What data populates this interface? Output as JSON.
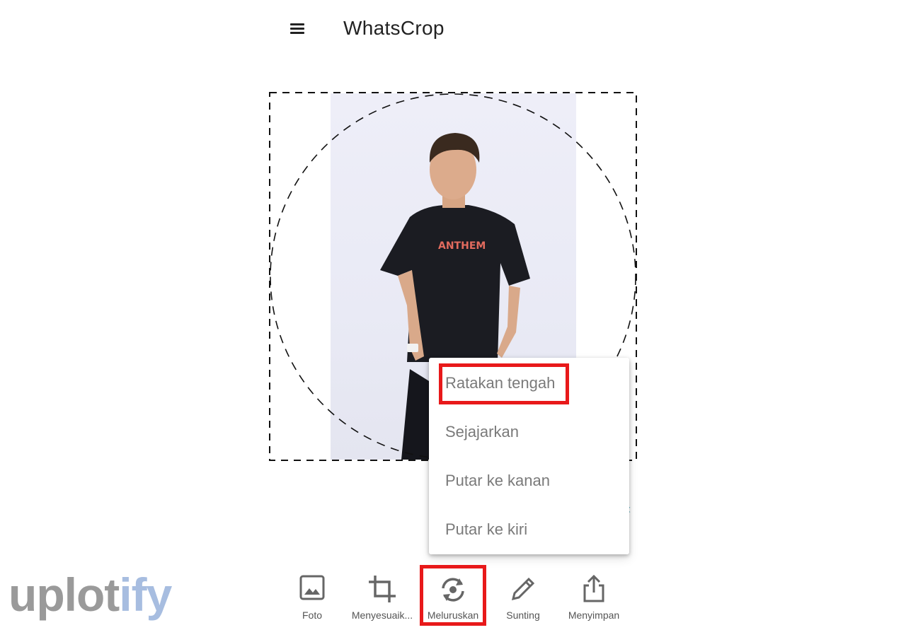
{
  "app": {
    "title": "WhatsCrop"
  },
  "photo": {
    "shirt_text": "ANTHEM"
  },
  "dropdown": {
    "items": [
      {
        "label": "Ratakan tengah",
        "highlighted": true
      },
      {
        "label": "Sejajarkan"
      },
      {
        "label": "Putar ke kanan"
      },
      {
        "label": "Putar ke kiri"
      }
    ]
  },
  "toolbar": {
    "items": [
      {
        "label": "Foto",
        "icon": "image-icon"
      },
      {
        "label": "Menyesuaik...",
        "icon": "crop-icon"
      },
      {
        "label": "Meluruskan",
        "icon": "rotate-icon",
        "highlighted": true
      },
      {
        "label": "Sunting",
        "icon": "pencil-icon"
      },
      {
        "label": "Menyimpan",
        "icon": "share-icon"
      }
    ]
  },
  "watermark": {
    "part1": "uplot",
    "part2": "ify"
  },
  "colors": {
    "highlight": "#e8191a",
    "watermark_gray": "#9a9a9a",
    "watermark_blue": "#a7bde0"
  }
}
